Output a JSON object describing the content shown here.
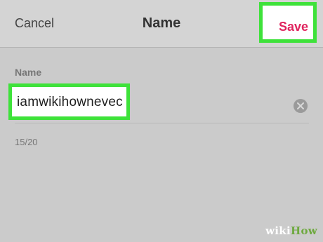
{
  "header": {
    "cancel_label": "Cancel",
    "title": "Name",
    "save_label": "Save"
  },
  "form": {
    "field_label": "Name",
    "name_value": "iamwikihownevec",
    "clear_icon": "close-circle-icon",
    "char_counter": "15/20"
  },
  "watermark": {
    "wiki": "wiki",
    "how": "How"
  },
  "colors": {
    "accent": "#e0245e",
    "highlight": "#3ee23a",
    "background": "#cbcbcb"
  }
}
